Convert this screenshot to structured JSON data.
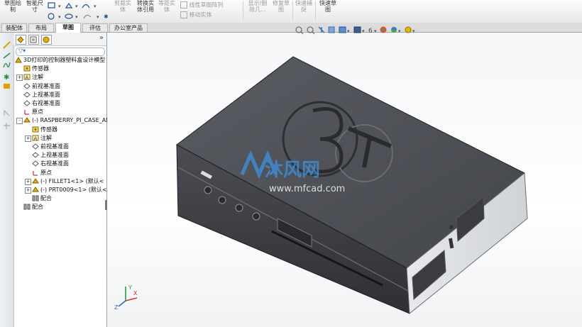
{
  "ribbon": {
    "tools": [
      {
        "label": "草图绘\n制",
        "dim": false
      },
      {
        "label": "智能尺\n寸",
        "dim": false
      },
      {
        "label": "剪裁实\n体",
        "dim": true
      },
      {
        "label": "转换实\n体引用",
        "dim": false
      },
      {
        "label": "等距实\n体",
        "dim": true
      },
      {
        "label": "线性草图阵列",
        "dim": true
      },
      {
        "label": "移动实体",
        "dim": true
      },
      {
        "label": "显示/删\n除几...",
        "dim": true
      },
      {
        "label": "修复草\n图",
        "dim": true
      },
      {
        "label": "快速捕\n捉",
        "dim": true
      },
      {
        "label": "快速草\n图",
        "dim": false
      }
    ]
  },
  "tabs": [
    {
      "label": "装配体",
      "active": false
    },
    {
      "label": "布局",
      "active": false
    },
    {
      "label": "草图",
      "active": true
    },
    {
      "label": "评估",
      "active": false
    },
    {
      "label": "办公室产品",
      "active": false
    }
  ],
  "panel": {
    "collapse_glyph": "»",
    "filter_glyph": "▽▾",
    "tree": [
      {
        "label": "3D打印的控制器塑料盒设计模型",
        "icon": "assembly-icon",
        "level": 0,
        "expander": ""
      },
      {
        "label": "传感器",
        "icon": "sensor-icon",
        "level": 1,
        "expander": ""
      },
      {
        "label": "注解",
        "icon": "annotation-icon",
        "level": 1,
        "expander": "+"
      },
      {
        "label": "前视基准面",
        "icon": "plane-icon",
        "level": 1,
        "expander": ""
      },
      {
        "label": "上视基准面",
        "icon": "plane-icon",
        "level": 1,
        "expander": ""
      },
      {
        "label": "右视基准面",
        "icon": "plane-icon",
        "level": 1,
        "expander": ""
      },
      {
        "label": "原点",
        "icon": "origin-icon",
        "level": 1,
        "expander": ""
      },
      {
        "label": "(-) RASPBERRY_PI_CASE_AN",
        "icon": "part-icon",
        "level": 1,
        "expander": "-"
      },
      {
        "label": "传感器",
        "icon": "sensor-icon",
        "level": 2,
        "expander": ""
      },
      {
        "label": "注解",
        "icon": "annotation-icon",
        "level": 2,
        "expander": "+"
      },
      {
        "label": "前视基准面",
        "icon": "plane-icon",
        "level": 2,
        "expander": ""
      },
      {
        "label": "上视基准面",
        "icon": "plane-icon",
        "level": 2,
        "expander": ""
      },
      {
        "label": "右视基准面",
        "icon": "plane-icon",
        "level": 2,
        "expander": ""
      },
      {
        "label": "原点",
        "icon": "origin-icon",
        "level": 2,
        "expander": ""
      },
      {
        "label": "(-) FILLET1<1> (默认<",
        "icon": "part-icon",
        "level": 2,
        "expander": "+"
      },
      {
        "label": "(-) PRT0009<1> (默认<",
        "icon": "part-icon",
        "level": 2,
        "expander": "+"
      },
      {
        "label": "配合",
        "icon": "mate-icon",
        "level": 2,
        "expander": ""
      },
      {
        "label": "配合",
        "icon": "mate-icon",
        "level": 1,
        "expander": ""
      }
    ]
  },
  "viewport": {
    "watermark_name": "沐风网",
    "watermark_url": "www.mfcad.com",
    "axis_labels": [
      "Y",
      "X",
      "Z"
    ]
  },
  "colors": {
    "accent": "#2f6fb5",
    "case_top": "#505259",
    "case_side": "#3a3c42",
    "watermark": "#3d8fd8"
  }
}
